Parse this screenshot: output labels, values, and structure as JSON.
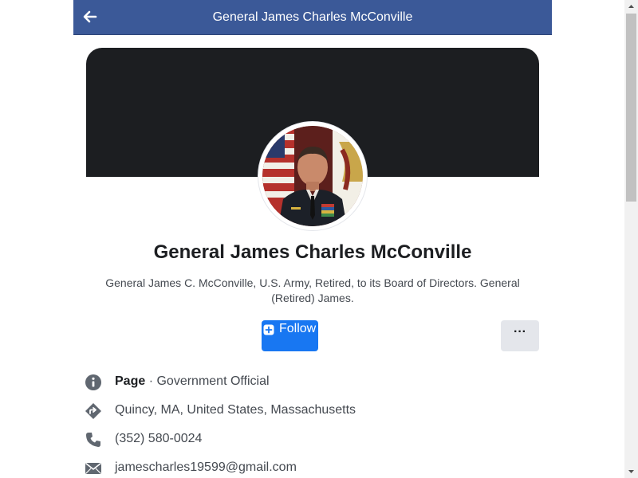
{
  "header": {
    "title": "General James Charles McConville",
    "back_icon": "arrow-left-icon",
    "background": "#3b5998"
  },
  "profile": {
    "name": "General James Charles McConville",
    "description": "General James C. McConville, U.S. Army, Retired, to its Board of Directors. General (Retired) James.",
    "cover_color": "#1c1e21",
    "avatar_icon": "profile-photo"
  },
  "actions": {
    "follow_label": "Follow",
    "follow_icon": "plus-square-icon",
    "follow_color": "#1877f2",
    "more_label": "···",
    "more_icon": "more-dots-icon"
  },
  "info": {
    "category": {
      "icon": "info-circle-icon",
      "type": "Page",
      "separator": " · ",
      "label": "Government Official"
    },
    "location": {
      "icon": "directions-icon",
      "text": "Quincy, MA, United States, Massachusetts"
    },
    "phone": {
      "icon": "phone-icon",
      "text": "(352) 580-0024"
    },
    "email": {
      "icon": "envelope-icon",
      "text": "jamescharles19599@gmail.com"
    }
  },
  "scrollbar": {
    "up_icon": "scroll-up-arrow",
    "down_icon": "scroll-down-arrow"
  }
}
